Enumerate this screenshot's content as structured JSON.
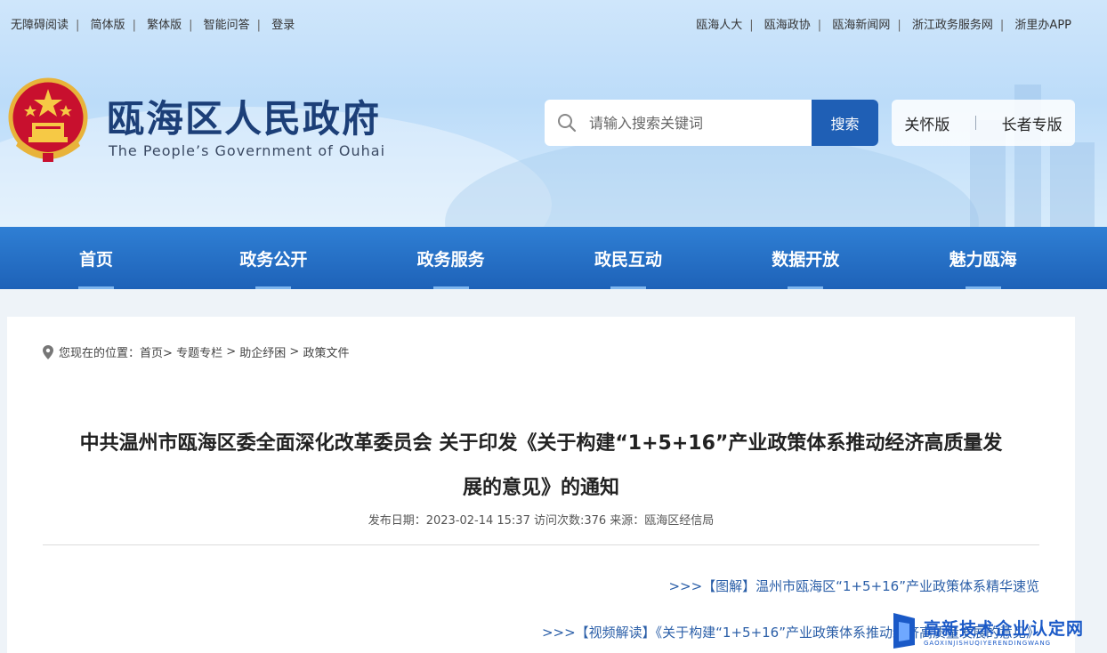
{
  "topbar": {
    "left": [
      "无障碍阅读",
      "简体版",
      "繁体版",
      "智能问答",
      "登录"
    ],
    "right": [
      "瓯海人大",
      "瓯海政协",
      "瓯海新闻网",
      "浙江政务服务网",
      "浙里办APP"
    ]
  },
  "site": {
    "title": "瓯海区人民政府",
    "subtitle": "The People’s Government of Ouhai"
  },
  "search": {
    "placeholder": "请输入搜索关键词",
    "button": "搜索"
  },
  "modes": [
    "关怀版",
    "长者专版"
  ],
  "nav": [
    "首页",
    "政务公开",
    "政务服务",
    "政民互动",
    "数据开放",
    "魅力瓯海"
  ],
  "breadcrumb": {
    "prefix": "您现在的位置：",
    "items": [
      "首页>",
      "专题专栏",
      ">",
      "助企纾困",
      ">",
      "政策文件"
    ]
  },
  "article": {
    "title_line1": "中共温州市瓯海区委全面深化改革委员会 关于印发《关于构建“1+5+16”产业政策体系推动经济高质量发",
    "title_line2": "展的意见》的通知",
    "meta": "发布日期：2023-02-14 15:37 访问次数:376 来源：瓯海区经信局",
    "link1": ">>>【图解】温州市瓯海区“1+5+16”产业政策体系精华速览",
    "link2": ">>>【视频解读】《关于构建“1+5+16”产业政策体系推动经济高质量发展的意见》"
  },
  "watermark": {
    "main": "高新技术企业认定网",
    "sub": "GAOXINJISHUQIYERENDINGWANG"
  },
  "colors": {
    "nav_blue": "#1e62b8",
    "title_navy": "#1c3f78",
    "link_blue": "#2b5fa8"
  }
}
